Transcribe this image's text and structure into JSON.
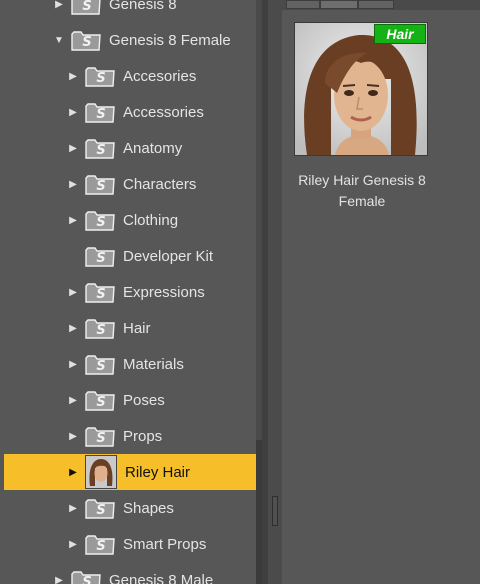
{
  "tree": {
    "items": [
      {
        "label": "Genesis 8",
        "expanded": false,
        "has_children": true,
        "selected": false
      },
      {
        "label": "Genesis 8 Female",
        "expanded": true,
        "has_children": true,
        "selected": false
      },
      {
        "label": "Accesories",
        "has_children": true,
        "selected": false
      },
      {
        "label": "Accessories",
        "has_children": true,
        "selected": false
      },
      {
        "label": "Anatomy",
        "has_children": true,
        "selected": false
      },
      {
        "label": "Characters",
        "has_children": true,
        "selected": false
      },
      {
        "label": "Clothing",
        "has_children": true,
        "selected": false
      },
      {
        "label": "Developer Kit",
        "has_children": false,
        "selected": false
      },
      {
        "label": "Expressions",
        "has_children": true,
        "selected": false
      },
      {
        "label": "Hair",
        "has_children": true,
        "selected": false
      },
      {
        "label": "Materials",
        "has_children": true,
        "selected": false
      },
      {
        "label": "Poses",
        "has_children": true,
        "selected": false
      },
      {
        "label": "Props",
        "has_children": true,
        "selected": false
      },
      {
        "label": "Riley Hair",
        "has_children": true,
        "selected": true,
        "icon": "product-thumbnail"
      },
      {
        "label": "Shapes",
        "has_children": true,
        "selected": false
      },
      {
        "label": "Smart Props",
        "has_children": true,
        "selected": false
      },
      {
        "label": "Genesis 8 Male",
        "expanded": false,
        "has_children": true,
        "selected": false
      }
    ],
    "folder_icon": "content-folder-icon"
  },
  "content": {
    "product": {
      "badge": "Hair",
      "name": "Riley Hair Genesis 8 Female"
    }
  },
  "colors": {
    "selection": "#f6bf29",
    "badge_green": "#14b214",
    "panel_bg": "#575757"
  }
}
